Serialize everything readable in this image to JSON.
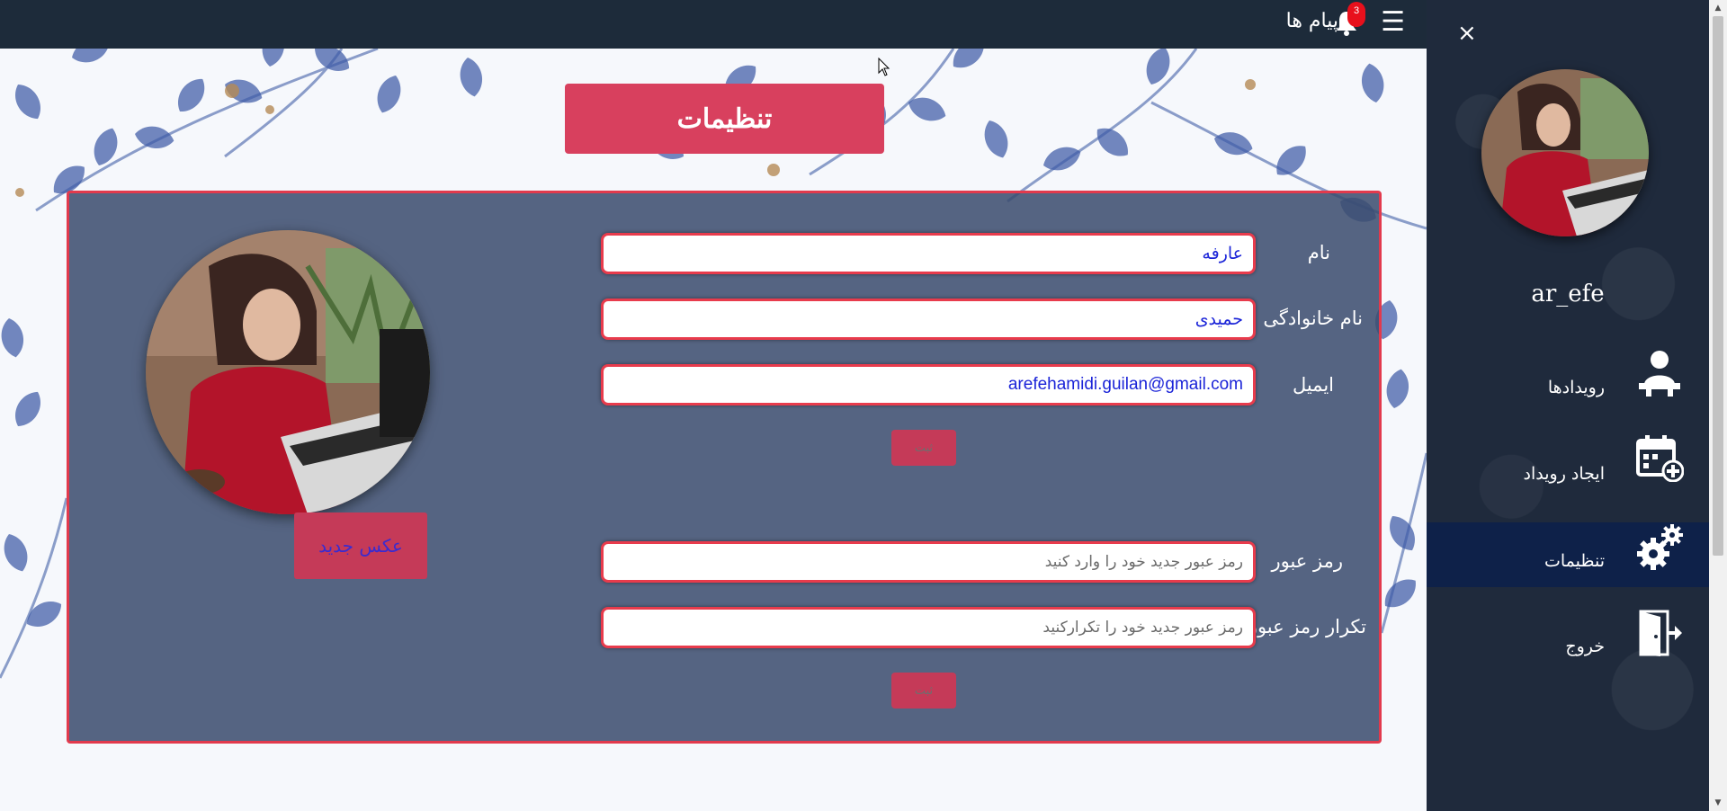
{
  "topbar": {
    "menu_icon": "☰",
    "bell_icon": "bell-icon",
    "notification_count": "3",
    "messages_label": "پیام ها"
  },
  "page_title": "تنظیمات",
  "profile_form": {
    "first_name": {
      "label": "نام",
      "value": "عارفه"
    },
    "last_name": {
      "label": "نام خانوادگی",
      "value": "حمیدی"
    },
    "email": {
      "label": "ایمیل",
      "value": "arefehamidi.guilan@gmail.com"
    },
    "submit_label": "ثبت"
  },
  "password_form": {
    "password": {
      "label": "رمز عبور",
      "placeholder": "رمز عبور جدید خود را وارد کنید"
    },
    "confirm": {
      "label": "تکرار رمز عبور",
      "placeholder": "رمز عبور جدید خود را تکرارکنید"
    },
    "submit_label": "ثبت"
  },
  "photo": {
    "new_photo_label": "عکس جدید"
  },
  "sidebar": {
    "close_icon": "×",
    "username": "ar_efe",
    "items": [
      {
        "label": "رویدادها",
        "icon": "user-desk-icon",
        "active": false
      },
      {
        "label": "ایجاد رویداد",
        "icon": "calendar-add-icon",
        "active": false
      },
      {
        "label": "تنظیمات",
        "icon": "gears-icon",
        "active": true
      },
      {
        "label": "خروج",
        "icon": "exit-door-icon",
        "active": false
      }
    ]
  },
  "colors": {
    "topbar": "#1d2b3a",
    "accent_red": "#d8405e",
    "panel": "#3a4c6e",
    "sidebar": "#1f2a3c",
    "sidebar_active": "#0e2149",
    "input_text": "#1b24d8"
  }
}
